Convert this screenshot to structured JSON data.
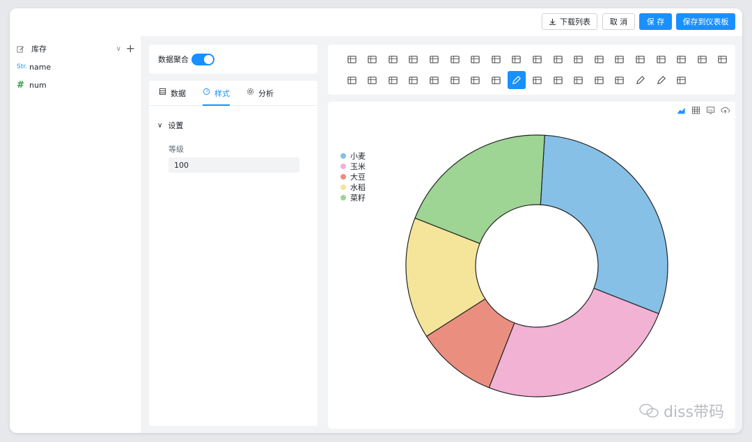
{
  "toolbar": {
    "download_label": "下载列表",
    "cancel_label": "取 消",
    "save_label": "保 存",
    "save_dashboard_label": "保存到仪表板"
  },
  "left_panel": {
    "title": "库存",
    "fields": [
      {
        "type": "Str.",
        "name": "name"
      },
      {
        "type": "#",
        "name": "num"
      }
    ]
  },
  "aggregation": {
    "label": "数据聚合",
    "enabled": true
  },
  "tabs": [
    {
      "label": "数据",
      "icon": "table-icon",
      "active": false
    },
    {
      "label": "样式",
      "icon": "style-icon",
      "active": true
    },
    {
      "label": "分析",
      "icon": "settings-icon",
      "active": false
    }
  ],
  "settings": {
    "section_title": "设置",
    "level_label": "等级",
    "level_value": "100"
  },
  "chart_types_row1": [
    "table",
    "pivot",
    "kpi",
    "kpi-compare",
    "bar",
    "hbar",
    "column",
    "hbar-stack",
    "stacked",
    "column-stack",
    "bar-line",
    "line",
    "area",
    "area-stack",
    "scatter",
    "pie",
    "donut",
    "map",
    "funnel"
  ],
  "chart_types_row2": [
    "waterfall",
    "wordcloud",
    "map-china",
    "map-world",
    "gauge",
    "text",
    "sparkline",
    "dots",
    "pencil",
    "cylinder",
    "cube",
    "pin",
    "map-pin",
    "rocket",
    "pencil-2",
    "pencil-3",
    "box"
  ],
  "selected_chart_type": "pencil",
  "chart_tools": [
    "area-chart-icon",
    "table-grid-icon",
    "sql-icon",
    "cloud-upload-icon"
  ],
  "chart_data": {
    "type": "pie",
    "categories": [
      "小麦",
      "玉米",
      "大豆",
      "水稻",
      "菜籽"
    ],
    "values": [
      30,
      25,
      10,
      15,
      20
    ],
    "colors": [
      "#86c0e6",
      "#f1b2d4",
      "#ea8f7f",
      "#f4e59b",
      "#9ed494"
    ]
  },
  "watermark": "diss带码"
}
